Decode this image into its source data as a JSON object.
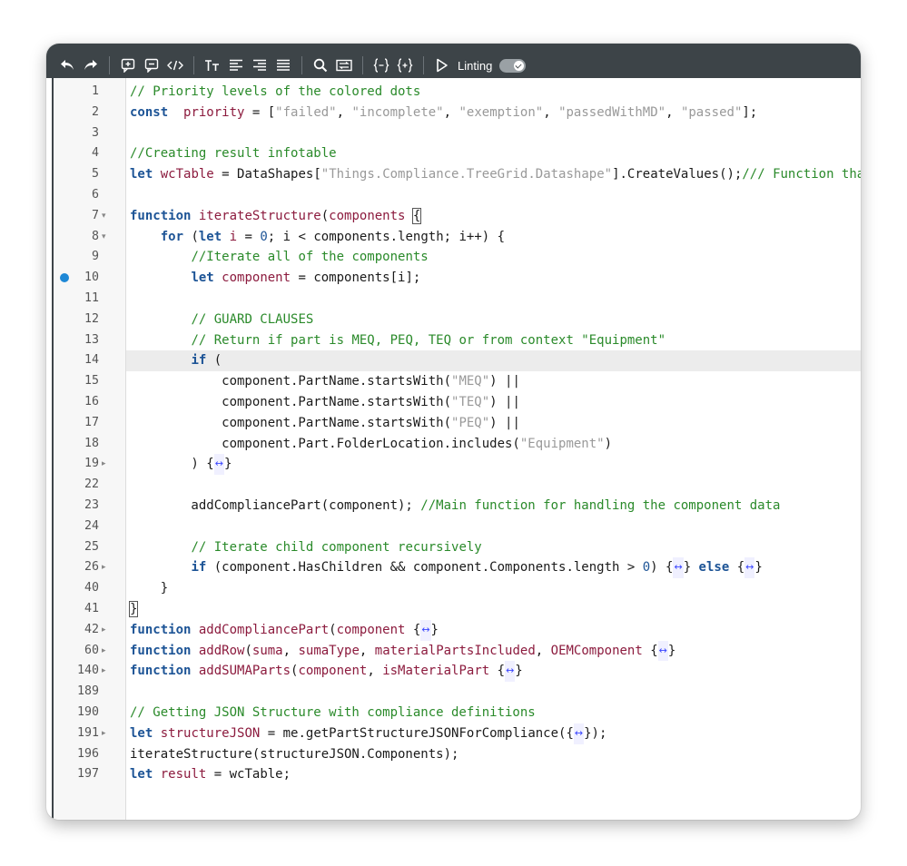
{
  "toolbar": {
    "icons": [
      "undo-icon",
      "redo-icon",
      "add-comment-icon",
      "comment-icon",
      "code-tag-icon",
      "text-size-icon",
      "align-left-icon",
      "align-right-icon",
      "justify-icon",
      "search-icon",
      "replace-icon",
      "fold-braces-icon",
      "unfold-braces-icon",
      "run-icon"
    ],
    "linting_label": "Linting",
    "linting_enabled": true
  },
  "colors": {
    "toolbar_bg": "#3d4448",
    "keyword": "#1d5496",
    "identifier": "#8c1b3e",
    "string": "#999999",
    "comment": "#2a8a2a",
    "breakpoint": "#1e88d6",
    "fold_marker": "#3a46ff"
  },
  "editor": {
    "active_line": "14",
    "breakpoint_line": "10",
    "lines": [
      {
        "n": "1",
        "fold": "",
        "tokens": [
          [
            "com",
            "// Priority levels of the colored dots"
          ]
        ]
      },
      {
        "n": "2",
        "fold": "",
        "tokens": [
          [
            "kw",
            "const"
          ],
          [
            "",
            "  "
          ],
          [
            "var",
            "priority"
          ],
          [
            "",
            " = ["
          ],
          [
            "str",
            "\"failed\""
          ],
          [
            "",
            ", "
          ],
          [
            "str",
            "\"incomplete\""
          ],
          [
            "",
            ", "
          ],
          [
            "str",
            "\"exemption\""
          ],
          [
            "",
            ", "
          ],
          [
            "str",
            "\"passedWithMD\""
          ],
          [
            "",
            ", "
          ],
          [
            "str",
            "\"passed\""
          ],
          [
            "",
            "];"
          ]
        ]
      },
      {
        "n": "3",
        "fold": "",
        "tokens": []
      },
      {
        "n": "4",
        "fold": "",
        "tokens": [
          [
            "com",
            "//Creating result infotable"
          ]
        ]
      },
      {
        "n": "5",
        "fold": "",
        "tokens": [
          [
            "kw",
            "let"
          ],
          [
            "",
            " "
          ],
          [
            "var",
            "wcTable"
          ],
          [
            "",
            " = DataShapes["
          ],
          [
            "str",
            "\"Things.Compliance.TreeGrid.Datashape\""
          ],
          [
            "",
            "].CreateValues();"
          ],
          [
            "com",
            "/// Function that iterates trough the structure"
          ]
        ]
      },
      {
        "n": "6",
        "fold": "",
        "tokens": []
      },
      {
        "n": "7",
        "fold": "▾",
        "tokens": [
          [
            "kw",
            "function"
          ],
          [
            "",
            " "
          ],
          [
            "fn",
            "iterateStructure"
          ],
          [
            "",
            "("
          ],
          [
            "var",
            "components"
          ],
          [
            "",
            " "
          ],
          [
            "brace",
            "{"
          ]
        ]
      },
      {
        "n": "8",
        "fold": "▾",
        "tokens": [
          [
            "",
            "    "
          ],
          [
            "kw",
            "for"
          ],
          [
            "",
            " ("
          ],
          [
            "kw",
            "let"
          ],
          [
            "",
            " "
          ],
          [
            "var",
            "i"
          ],
          [
            "",
            " = "
          ],
          [
            "num",
            "0"
          ],
          [
            "",
            "; i < components.length; i++) {"
          ]
        ]
      },
      {
        "n": "9",
        "fold": "",
        "tokens": [
          [
            "",
            "        "
          ],
          [
            "com",
            "//Iterate all of the components"
          ]
        ]
      },
      {
        "n": "10",
        "fold": "",
        "tokens": [
          [
            "",
            "        "
          ],
          [
            "kw",
            "let"
          ],
          [
            "",
            " "
          ],
          [
            "var",
            "component"
          ],
          [
            "",
            " = components[i];"
          ]
        ]
      },
      {
        "n": "11",
        "fold": "",
        "tokens": []
      },
      {
        "n": "12",
        "fold": "",
        "tokens": [
          [
            "",
            "        "
          ],
          [
            "com",
            "// GUARD CLAUSES"
          ]
        ]
      },
      {
        "n": "13",
        "fold": "",
        "tokens": [
          [
            "",
            "        "
          ],
          [
            "com",
            "// Return if part is MEQ, PEQ, TEQ or from context \"Equipment\""
          ]
        ]
      },
      {
        "n": "14",
        "fold": "",
        "tokens": [
          [
            "",
            "        "
          ],
          [
            "kw",
            "if"
          ],
          [
            "",
            " ("
          ]
        ]
      },
      {
        "n": "15",
        "fold": "",
        "tokens": [
          [
            "",
            "            component.PartName.startsWith("
          ],
          [
            "str",
            "\"MEQ\""
          ],
          [
            "",
            ") ||"
          ]
        ]
      },
      {
        "n": "16",
        "fold": "",
        "tokens": [
          [
            "",
            "            component.PartName.startsWith("
          ],
          [
            "str",
            "\"TEQ\""
          ],
          [
            "",
            ") ||"
          ]
        ]
      },
      {
        "n": "17",
        "fold": "",
        "tokens": [
          [
            "",
            "            component.PartName.startsWith("
          ],
          [
            "str",
            "\"PEQ\""
          ],
          [
            "",
            ") ||"
          ]
        ]
      },
      {
        "n": "18",
        "fold": "",
        "tokens": [
          [
            "",
            "            component.Part.FolderLocation.includes("
          ],
          [
            "str",
            "\"Equipment\""
          ],
          [
            "",
            ")"
          ]
        ]
      },
      {
        "n": "19",
        "fold": "▸",
        "tokens": [
          [
            "",
            "        ) {"
          ],
          [
            "mark",
            "↔"
          ],
          [
            "",
            "}"
          ]
        ]
      },
      {
        "n": "22",
        "fold": "",
        "tokens": []
      },
      {
        "n": "23",
        "fold": "",
        "tokens": [
          [
            "",
            "        addCompliancePart(component); "
          ],
          [
            "com",
            "//Main function for handling the component data"
          ]
        ]
      },
      {
        "n": "24",
        "fold": "",
        "tokens": []
      },
      {
        "n": "25",
        "fold": "",
        "tokens": [
          [
            "",
            "        "
          ],
          [
            "com",
            "// Iterate child component recursively"
          ]
        ]
      },
      {
        "n": "26",
        "fold": "▸",
        "tokens": [
          [
            "",
            "        "
          ],
          [
            "kw",
            "if"
          ],
          [
            "",
            " (component.HasChildren && component.Components.length > "
          ],
          [
            "num",
            "0"
          ],
          [
            "",
            ") {"
          ],
          [
            "mark",
            "↔"
          ],
          [
            "",
            "} "
          ],
          [
            "kw",
            "else"
          ],
          [
            "",
            " {"
          ],
          [
            "mark",
            "↔"
          ],
          [
            "",
            "}"
          ]
        ]
      },
      {
        "n": "40",
        "fold": "",
        "tokens": [
          [
            "",
            "    }"
          ]
        ]
      },
      {
        "n": "41",
        "fold": "",
        "tokens": [
          [
            "brace",
            "}"
          ]
        ]
      },
      {
        "n": "42",
        "fold": "▸",
        "tokens": [
          [
            "kw",
            "function"
          ],
          [
            "",
            " "
          ],
          [
            "fn",
            "addCompliancePart"
          ],
          [
            "",
            "("
          ],
          [
            "var",
            "component"
          ],
          [
            "",
            " {"
          ],
          [
            "mark",
            "↔"
          ],
          [
            "",
            "}"
          ]
        ]
      },
      {
        "n": "60",
        "fold": "▸",
        "tokens": [
          [
            "kw",
            "function"
          ],
          [
            "",
            " "
          ],
          [
            "fn",
            "addRow"
          ],
          [
            "",
            "("
          ],
          [
            "var",
            "suma"
          ],
          [
            "",
            ", "
          ],
          [
            "var",
            "sumaType"
          ],
          [
            "",
            ", "
          ],
          [
            "var",
            "materialPartsIncluded"
          ],
          [
            "",
            ", "
          ],
          [
            "var",
            "OEMComponent"
          ],
          [
            "",
            " {"
          ],
          [
            "mark",
            "↔"
          ],
          [
            "",
            "}"
          ]
        ]
      },
      {
        "n": "140",
        "fold": "▸",
        "tokens": [
          [
            "kw",
            "function"
          ],
          [
            "",
            " "
          ],
          [
            "fn",
            "addSUMAParts"
          ],
          [
            "",
            "("
          ],
          [
            "var",
            "component"
          ],
          [
            "",
            ", "
          ],
          [
            "var",
            "isMaterialPart"
          ],
          [
            "",
            " {"
          ],
          [
            "mark",
            "↔"
          ],
          [
            "",
            "}"
          ]
        ]
      },
      {
        "n": "189",
        "fold": "",
        "tokens": []
      },
      {
        "n": "190",
        "fold": "",
        "tokens": [
          [
            "com",
            "// Getting JSON Structure with compliance definitions"
          ]
        ]
      },
      {
        "n": "191",
        "fold": "▸",
        "tokens": [
          [
            "kw",
            "let"
          ],
          [
            "",
            " "
          ],
          [
            "var",
            "structureJSON"
          ],
          [
            "",
            " = me.getPartStructureJSONForCompliance({"
          ],
          [
            "mark",
            "↔"
          ],
          [
            "",
            "});"
          ]
        ]
      },
      {
        "n": "196",
        "fold": "",
        "tokens": [
          [
            "",
            "iterateStructure(structureJSON.Components);"
          ]
        ]
      },
      {
        "n": "197",
        "fold": "",
        "tokens": [
          [
            "kw",
            "let"
          ],
          [
            "",
            " "
          ],
          [
            "var",
            "result"
          ],
          [
            "",
            " = wcTable;"
          ]
        ]
      }
    ]
  }
}
